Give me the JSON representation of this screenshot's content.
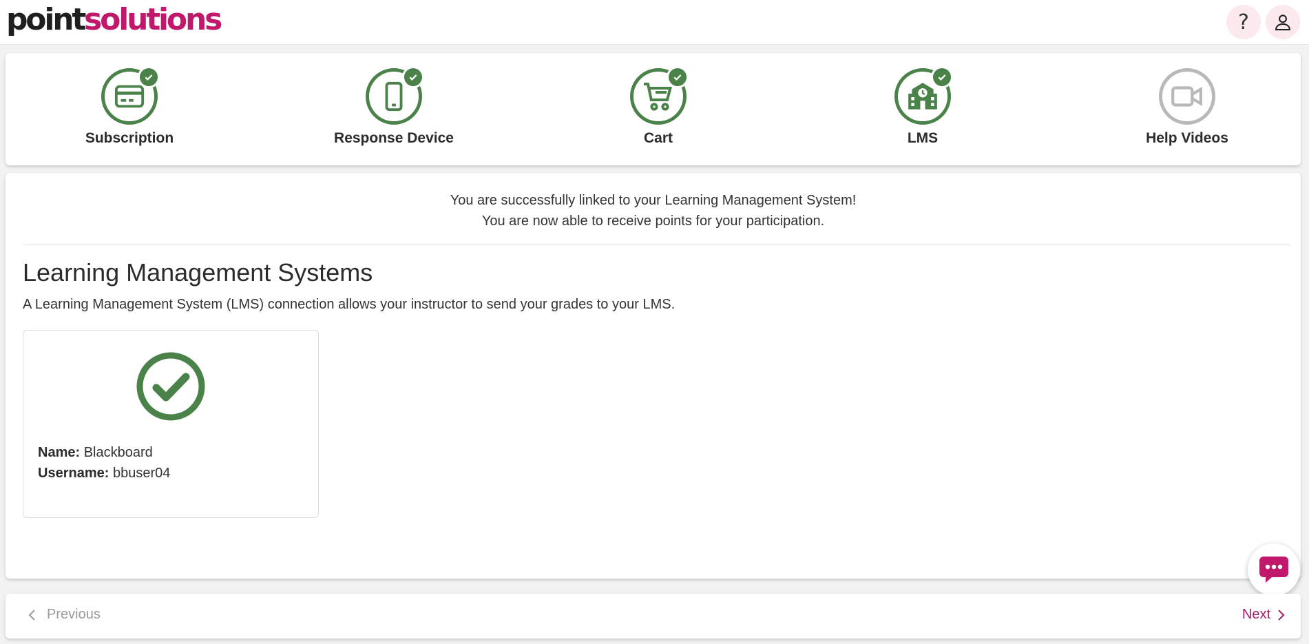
{
  "header": {
    "logo_part1": "point",
    "logo_part2": "solutions",
    "help_label": "?",
    "help_icon": "question-mark-icon",
    "user_icon": "user-icon"
  },
  "steps": [
    {
      "label": "Subscription",
      "icon": "credit-card-icon",
      "completed": true
    },
    {
      "label": "Response Device",
      "icon": "mobile-phone-icon",
      "completed": true
    },
    {
      "label": "Cart",
      "icon": "shopping-cart-icon",
      "completed": true
    },
    {
      "label": "LMS",
      "icon": "school-building-icon",
      "completed": true
    },
    {
      "label": "Help Videos",
      "icon": "video-camera-icon",
      "completed": false
    }
  ],
  "main": {
    "success_line1": "You are successfully linked to your Learning Management System!",
    "success_line2": "You are now able to receive points for your participation.",
    "title": "Learning Management Systems",
    "description": "A Learning Management System (LMS) connection allows your instructor to send your grades to your LMS.",
    "lms_card": {
      "name_label": "Name:",
      "name_value": "Blackboard",
      "username_label": "Username:",
      "username_value": "bbuser04",
      "status_icon": "check-circle-icon"
    }
  },
  "footer": {
    "previous_label": "Previous",
    "next_label": "Next"
  },
  "colors": {
    "brand_magenta": "#c2186b",
    "success_green": "#4a8249",
    "inactive_gray": "#b8b8b8",
    "next_link": "#a01f68"
  },
  "chat": {
    "icon": "chat-bubble-icon"
  }
}
